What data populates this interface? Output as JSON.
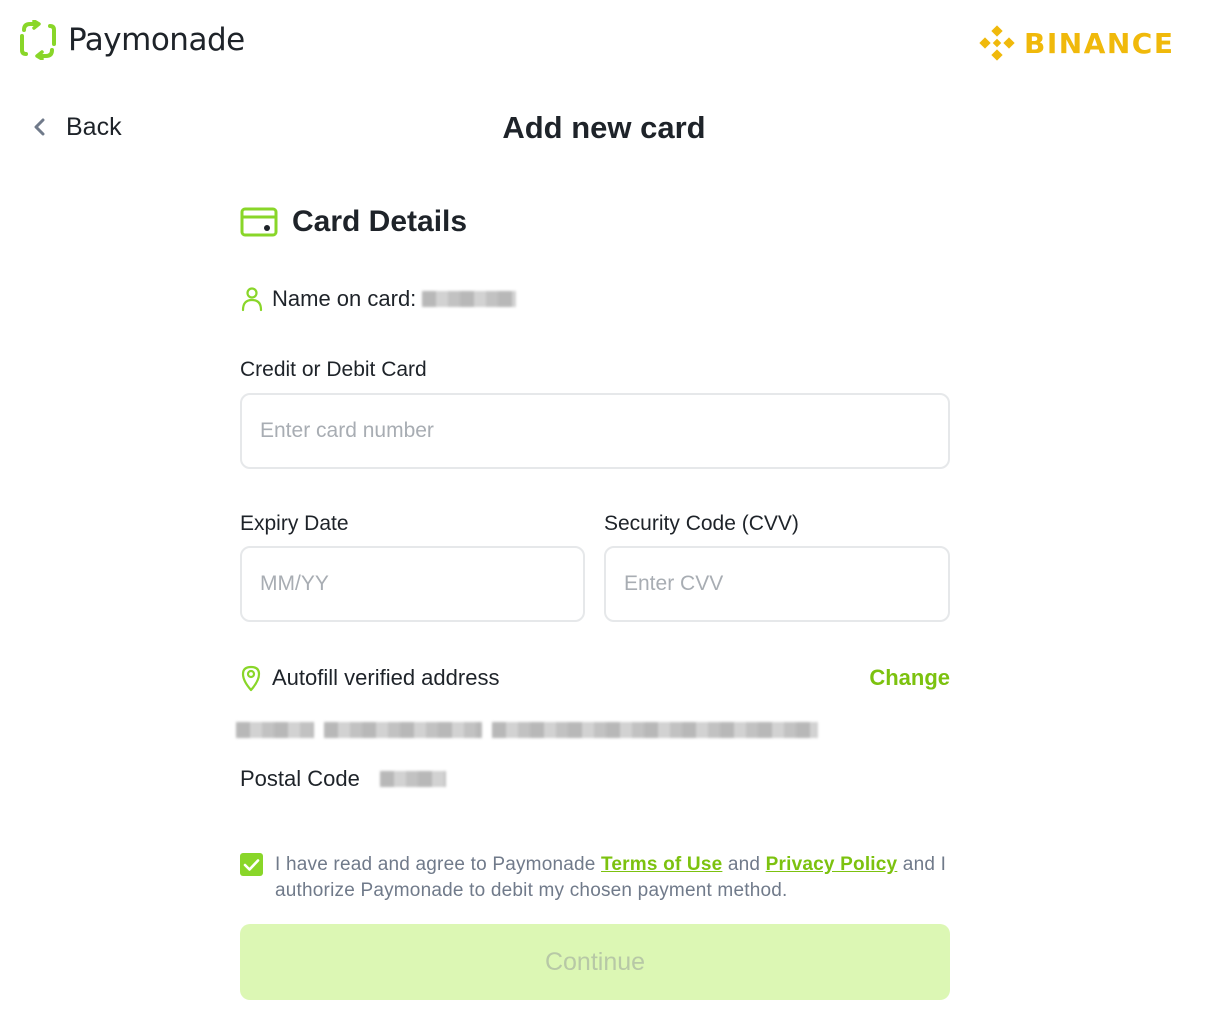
{
  "brand": {
    "name": "Paymonade",
    "accent": "#89d629"
  },
  "partner": {
    "name": "BINANCE",
    "color": "#f0b90b"
  },
  "nav": {
    "back_label": "Back"
  },
  "page": {
    "title": "Add new card"
  },
  "card_details": {
    "title": "Card Details",
    "name_label": "Name on card:",
    "card_number": {
      "label": "Credit or Debit Card",
      "placeholder": "Enter card number",
      "value": ""
    },
    "expiry": {
      "label": "Expiry Date",
      "placeholder": "MM/YY",
      "value": ""
    },
    "cvv": {
      "label": "Security Code (CVV)",
      "placeholder": "Enter CVV",
      "value": ""
    }
  },
  "address": {
    "label": "Autofill verified address",
    "change_label": "Change",
    "postal_label": "Postal Code"
  },
  "agreement": {
    "checked": true,
    "text_before": "I have read and agree to Paymonade ",
    "terms_label": "Terms of Use",
    "text_middle": " and ",
    "privacy_label": "Privacy Policy",
    "text_after": " and I authorize Paymonade to debit my chosen payment method."
  },
  "actions": {
    "continue_label": "Continue",
    "continue_enabled": false
  }
}
